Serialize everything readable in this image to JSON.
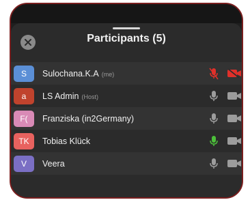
{
  "header": {
    "title": "Participants (5)"
  },
  "participants": [
    {
      "initials": "S",
      "name": "Sulochana.K.A",
      "role": "(me)",
      "avatar_color": "#5b8fd6",
      "mic": "muted",
      "camera": "off"
    },
    {
      "initials": "a",
      "name": "LS Admin",
      "role": "(Host)",
      "avatar_color": "#c0432d",
      "mic": "off",
      "camera": "off"
    },
    {
      "initials": "F(",
      "name": "Franziska (in2Germany)",
      "role": "",
      "avatar_color": "#d98ab6",
      "mic": "off",
      "camera": "off"
    },
    {
      "initials": "TK",
      "name": "Tobias Klück",
      "role": "",
      "avatar_color": "#e8625f",
      "mic": "active",
      "camera": "off"
    },
    {
      "initials": "V",
      "name": "Veera",
      "role": "",
      "avatar_color": "#7b6fc4",
      "mic": "off",
      "camera": "off"
    }
  ],
  "colors": {
    "muted_red": "#e0302a",
    "active_green": "#4cbf3a",
    "icon_gray": "#9c9c9c"
  },
  "icons": {
    "close": "close-icon",
    "mic": "microphone-icon",
    "mic_muted": "microphone-muted-icon",
    "camera": "video-camera-icon",
    "camera_off": "video-camera-off-icon"
  }
}
